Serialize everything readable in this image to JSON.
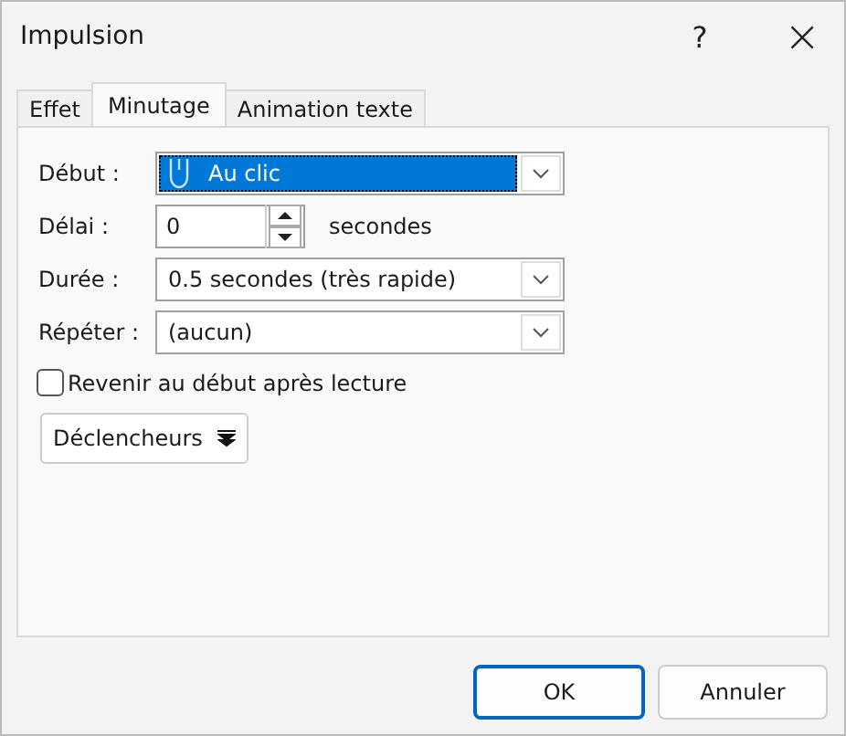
{
  "window": {
    "title": "Impulsion",
    "help": "?",
    "close": "×"
  },
  "tabs": [
    {
      "label": "Effet",
      "selected": false
    },
    {
      "label": "Minutage",
      "selected": true
    },
    {
      "label": "Animation texte",
      "selected": false
    }
  ],
  "fields": [
    {
      "kind": "combo",
      "label": "Début :",
      "value": "Au clic",
      "focused": true
    },
    {
      "kind": "spin",
      "label": "Délai :",
      "value": "0",
      "unit": "secondes"
    },
    {
      "kind": "combo",
      "label": "Durée :",
      "value": "0.5 secondes (très rapide)",
      "focused": false
    },
    {
      "kind": "combo",
      "label": "Répéter :",
      "value": "(aucun)",
      "focused": false
    }
  ],
  "rewind": {
    "label": "Revenir au début après lecture",
    "checked": false
  },
  "triggers_button": "Déclencheurs",
  "buttons": [
    {
      "label": "OK",
      "default": true
    },
    {
      "label": "Annuler",
      "default": false
    }
  ]
}
